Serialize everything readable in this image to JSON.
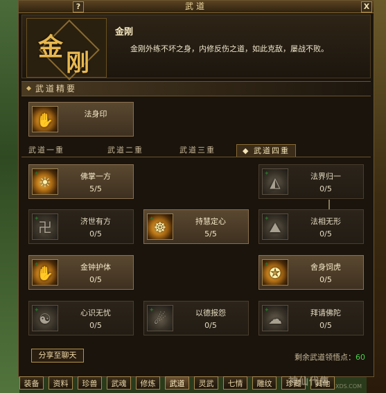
{
  "window": {
    "title": "武道",
    "help_label": "?",
    "close_label": "X"
  },
  "header": {
    "emblem_char_1": "金",
    "emblem_char_2": "刚",
    "name": "金刚",
    "description": "金刚外练不坏之身，内修反伤之道，如此克敌，屡战不败。"
  },
  "essence": {
    "section_title": "武道精要",
    "card": {
      "name": "法身印",
      "icon": "seal-icon"
    }
  },
  "tabs": [
    {
      "label": "武道一重",
      "active": false
    },
    {
      "label": "武道二重",
      "active": false
    },
    {
      "label": "武道三重",
      "active": false
    },
    {
      "label": "武道四重",
      "active": true,
      "marker": "◆"
    }
  ],
  "skills": [
    {
      "name": "佛掌一方",
      "points": "5/5",
      "icon": "palm-icon",
      "learned": true
    },
    {
      "name": "法界归一",
      "points": "0/5",
      "icon": "realm-icon",
      "learned": false
    },
    {
      "name": "济世有方",
      "points": "0/5",
      "icon": "swastika-icon",
      "learned": false
    },
    {
      "name": "持慧定心",
      "points": "5/5",
      "icon": "wisdom-icon",
      "learned": true
    },
    {
      "name": "法相无形",
      "points": "0/5",
      "icon": "form-icon",
      "learned": false
    },
    {
      "name": "金钟护体",
      "points": "0/5",
      "icon": "bell-icon",
      "learned": true
    },
    {
      "name": "舍身饲虎",
      "points": "0/5",
      "icon": "tiger-icon",
      "learned": true
    },
    {
      "name": "心识无忧",
      "points": "0/5",
      "icon": "mind-icon",
      "learned": false
    },
    {
      "name": "以德报怨",
      "points": "0/5",
      "icon": "virtue-icon",
      "learned": false
    },
    {
      "name": "拜请佛陀",
      "points": "0/5",
      "icon": "buddha-icon",
      "learned": false
    }
  ],
  "footer": {
    "share_label": "分享至聊天",
    "remaining_label": "剩余武道领悟点：",
    "remaining_value": "60"
  },
  "bottom_tabs": [
    {
      "label": "装备",
      "active": false
    },
    {
      "label": "资料",
      "active": false
    },
    {
      "label": "珍兽",
      "active": false
    },
    {
      "label": "武魂",
      "active": false
    },
    {
      "label": "修炼",
      "active": false
    },
    {
      "label": "武道",
      "active": true
    },
    {
      "label": "灵武",
      "active": false
    },
    {
      "label": "七情",
      "active": false
    },
    {
      "label": "雕纹",
      "active": false
    },
    {
      "label": "珍藏",
      "active": false
    },
    {
      "label": "其他",
      "active": false
    }
  ],
  "watermark": {
    "text": "神仙代售",
    "url_text": "XDS.COM"
  }
}
